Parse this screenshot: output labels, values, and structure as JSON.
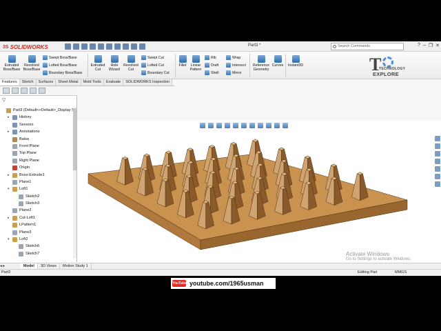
{
  "app": {
    "brand": "SOLIDWORKS",
    "brand_prefix": "3S",
    "doc_title": "Part3 *",
    "search_placeholder": "Search Commands",
    "window_controls": [
      "?",
      "–",
      "❐",
      "✕"
    ]
  },
  "ribbon": {
    "extruded_boss": "Extruded\nBoss/Base",
    "revolved_boss": "Revolved\nBoss/Base",
    "swept_boss": "Swept Boss/Base",
    "lofted_boss": "Lofted Boss/Base",
    "boundary_boss": "Boundary Boss/Base",
    "extruded_cut": "Extruded\nCut",
    "hole_wizard": "Hole\nWizard",
    "revolved_cut": "Revolved\nCut",
    "swept_cut": "Swept Cut",
    "lofted_cut": "Lofted Cut",
    "boundary_cut": "Boundary Cut",
    "fillet": "Fillet",
    "linear_pattern": "Linear\nPattern",
    "rib": "Rib",
    "draft": "Draft",
    "shell": "Shell",
    "wrap": "Wrap",
    "intersect": "Intersect",
    "mirror": "Mirror",
    "reference_geometry": "Reference\nGeometry",
    "curves": "Curves",
    "instant3d": "Instant3D"
  },
  "tabs": [
    "Features",
    "Sketch",
    "Surfaces",
    "Sheet Metal",
    "Mold Tools",
    "Evaluate",
    "SOLIDWORKS Inspection"
  ],
  "brand_logo": {
    "letter": "T",
    "line1": "TECHNOLOGY",
    "line2": "EXPLORE"
  },
  "tree": [
    {
      "label": "Part3  (Default<<Default>_Display St",
      "indent": 0,
      "arrow": "",
      "color": "#c8a04a"
    },
    {
      "label": "History",
      "indent": 1,
      "arrow": "▸",
      "color": "#7a94b8"
    },
    {
      "label": "Sensors",
      "indent": 1,
      "arrow": "",
      "color": "#7a94b8"
    },
    {
      "label": "Annotations",
      "indent": 1,
      "arrow": "▸",
      "color": "#7a94b8"
    },
    {
      "label": "Balsa",
      "indent": 1,
      "arrow": "",
      "color": "#b08a55"
    },
    {
      "label": "Front Plane",
      "indent": 1,
      "arrow": "",
      "color": "#9aa6b4"
    },
    {
      "label": "Top Plane",
      "indent": 1,
      "arrow": "",
      "color": "#9aa6b4"
    },
    {
      "label": "Right Plane",
      "indent": 1,
      "arrow": "",
      "color": "#9aa6b4"
    },
    {
      "label": "Origin",
      "indent": 1,
      "arrow": "",
      "color": "#c04040"
    },
    {
      "label": "Boss-Extrude1",
      "indent": 1,
      "arrow": "▸",
      "color": "#c8a04a"
    },
    {
      "label": "Plane1",
      "indent": 1,
      "arrow": "",
      "color": "#9aa6b4"
    },
    {
      "label": "Loft1",
      "indent": 1,
      "arrow": "▾",
      "color": "#c8a04a"
    },
    {
      "label": "Sketch2",
      "indent": 2,
      "arrow": "",
      "color": "#9aa6b4"
    },
    {
      "label": "Sketch3",
      "indent": 2,
      "arrow": "",
      "color": "#9aa6b4"
    },
    {
      "label": "Plane2",
      "indent": 1,
      "arrow": "",
      "color": "#9aa6b4"
    },
    {
      "label": "Cut-Loft1",
      "indent": 1,
      "arrow": "▸",
      "color": "#c8a04a"
    },
    {
      "label": "LPattern1",
      "indent": 1,
      "arrow": "",
      "color": "#c8a04a"
    },
    {
      "label": "Plane3",
      "indent": 1,
      "arrow": "",
      "color": "#9aa6b4"
    },
    {
      "label": "Loft2",
      "indent": 1,
      "arrow": "▾",
      "color": "#c8a04a"
    },
    {
      "label": "Sketch6",
      "indent": 2,
      "arrow": "",
      "color": "#9aa6b4"
    },
    {
      "label": "Sketch7",
      "indent": 2,
      "arrow": "",
      "color": "#9aa6b4"
    }
  ],
  "bottom_tabs": [
    "Model",
    "3D Views",
    "Motion Study 1"
  ],
  "status": {
    "left": "Part3",
    "editing": "Editing Part",
    "units": "MMGS"
  },
  "watermark": {
    "title": "Activate Windows",
    "subtitle": "Go to Settings to activate Windows."
  },
  "footer": {
    "badge": "YouTube",
    "url": "youtube.com/1965usman"
  },
  "model": {
    "rows": 5,
    "cols": 7,
    "wood_light": "#cfa470",
    "wood_dark": "#8a5a2b"
  }
}
